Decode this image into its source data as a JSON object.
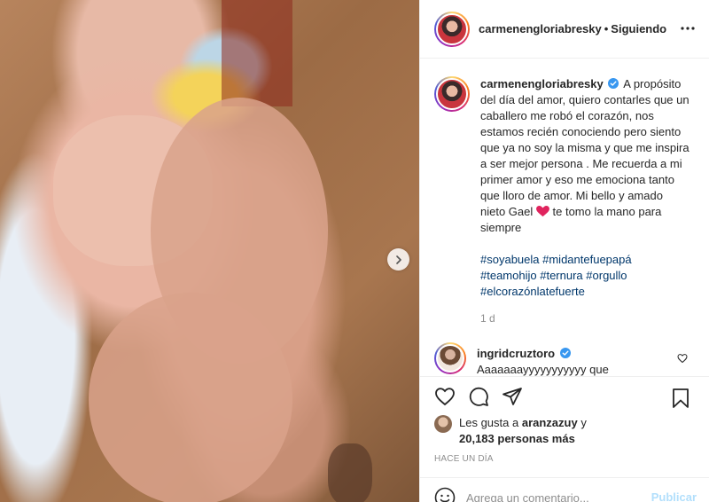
{
  "post": {
    "username": "carmenengloriabresky",
    "follow_status": "Siguiendo",
    "separator": "•"
  },
  "caption": {
    "username": "carmenengloriabresky",
    "text_part1": "A propósito del día del amor, quiero contarles que un caballero me robó el corazón, nos estamos recién conociendo pero siento que ya no soy la misma y que me inspira a ser mejor persona . Me recuerda a mi primer amor y eso me emociona tanto que lloro de amor. Mi bello y amado nieto Gael",
    "text_part2": "te tomo la mano para siempre",
    "hashtags": [
      "#soyabuela",
      "#midantefuepapá",
      "#teamohijo",
      "#ternura",
      "#orgullo",
      "#elcorazónlatefuerte"
    ],
    "age": "1 d"
  },
  "comment": {
    "username": "ingridcruztoro",
    "text": "Aaaaaaayyyyyyyyyyy que"
  },
  "likes": {
    "prefix": "Les gusta a",
    "user": "aranzazuy",
    "joiner": "y",
    "count_text": "20,183 personas más"
  },
  "timeago": "HACE UN DÍA",
  "add_comment": {
    "placeholder": "Agrega un comentario...",
    "publish_label": "Publicar"
  },
  "icons": {
    "like": "heart-icon",
    "comment": "comment-icon",
    "share": "send-icon",
    "save": "bookmark-icon",
    "emoji": "emoji-icon",
    "next": "chevron-right-icon",
    "more": "more-options-icon",
    "verified": "verified-badge-icon"
  },
  "colors": {
    "verified": "#3897f0",
    "hashtag": "#00376b",
    "muted": "#8e8e8e",
    "publish_disabled": "#b2dffc",
    "heart_emoji": "#e0245e"
  }
}
